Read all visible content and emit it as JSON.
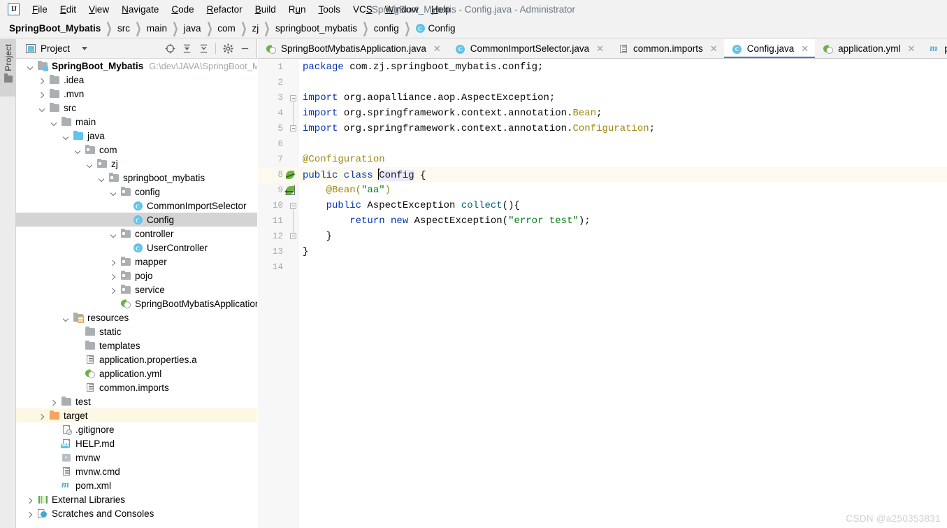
{
  "window": {
    "title": "SpringBoot_Mybatis - Config.java - Administrator",
    "logo": "IJ"
  },
  "menubar": {
    "items": [
      {
        "label": "File",
        "mnemonic": "F"
      },
      {
        "label": "Edit",
        "mnemonic": "E"
      },
      {
        "label": "View",
        "mnemonic": "V"
      },
      {
        "label": "Navigate",
        "mnemonic": "N"
      },
      {
        "label": "Code",
        "mnemonic": "C"
      },
      {
        "label": "Refactor",
        "mnemonic": "R"
      },
      {
        "label": "Build",
        "mnemonic": "B"
      },
      {
        "label": "Run",
        "mnemonic": "u"
      },
      {
        "label": "Tools",
        "mnemonic": "T"
      },
      {
        "label": "VCS",
        "mnemonic": "S"
      },
      {
        "label": "Window",
        "mnemonic": "W"
      },
      {
        "label": "Help",
        "mnemonic": "H"
      }
    ]
  },
  "breadcrumb": {
    "items": [
      "SpringBoot_Mybatis",
      "src",
      "main",
      "java",
      "com",
      "zj",
      "springboot_mybatis",
      "config",
      "Config"
    ],
    "last_icon": "class-icon",
    "last_badge": "C",
    "separator": "❯"
  },
  "toolstrip": {
    "project_tab": "Project",
    "project_tab_icon": "folder-icon"
  },
  "project_panel": {
    "title": "Project",
    "title_icon": "project-view-icon",
    "dropdown_icon": "chevron-down-icon",
    "tools": [
      {
        "name": "select-opened-file-icon"
      },
      {
        "name": "expand-all-icon"
      },
      {
        "name": "collapse-all-icon"
      },
      {
        "name": "settings-gear-icon"
      },
      {
        "name": "hide-panel-icon"
      }
    ],
    "tree": [
      {
        "label": "SpringBoot_Mybatis",
        "path": "G:\\dev\\JAVA\\SpringBoot_Myb",
        "indent": 0,
        "arrow": "down",
        "icon": "module-folder-icon",
        "bold": true,
        "state": "none"
      },
      {
        "label": ".idea",
        "indent": 1,
        "arrow": "right",
        "icon": "folder-icon",
        "state": "none"
      },
      {
        "label": ".mvn",
        "indent": 1,
        "arrow": "right",
        "icon": "folder-icon",
        "state": "none"
      },
      {
        "label": "src",
        "indent": 1,
        "arrow": "down",
        "icon": "folder-icon",
        "state": "none"
      },
      {
        "label": "main",
        "indent": 2,
        "arrow": "down",
        "icon": "folder-icon",
        "state": "none"
      },
      {
        "label": "java",
        "indent": 3,
        "arrow": "down",
        "icon": "source-folder-icon",
        "state": "none"
      },
      {
        "label": "com",
        "indent": 4,
        "arrow": "down",
        "icon": "package-icon",
        "state": "none"
      },
      {
        "label": "zj",
        "indent": 5,
        "arrow": "down",
        "icon": "package-icon",
        "state": "none"
      },
      {
        "label": "springboot_mybatis",
        "indent": 6,
        "arrow": "down",
        "icon": "package-icon",
        "state": "none"
      },
      {
        "label": "config",
        "indent": 7,
        "arrow": "down",
        "icon": "package-icon",
        "state": "none"
      },
      {
        "label": "CommonImportSelector",
        "indent": 8,
        "arrow": "none",
        "icon": "class-icon",
        "state": "none"
      },
      {
        "label": "Config",
        "indent": 8,
        "arrow": "none",
        "icon": "class-icon",
        "state": "selected"
      },
      {
        "label": "controller",
        "indent": 7,
        "arrow": "down",
        "icon": "package-icon",
        "state": "none"
      },
      {
        "label": "UserController",
        "indent": 8,
        "arrow": "none",
        "icon": "class-icon",
        "state": "none"
      },
      {
        "label": "mapper",
        "indent": 7,
        "arrow": "right",
        "icon": "package-icon",
        "state": "none"
      },
      {
        "label": "pojo",
        "indent": 7,
        "arrow": "right",
        "icon": "package-icon",
        "state": "none"
      },
      {
        "label": "service",
        "indent": 7,
        "arrow": "right",
        "icon": "package-icon",
        "state": "none"
      },
      {
        "label": "SpringBootMybatisApplication",
        "indent": 7,
        "arrow": "none",
        "icon": "spring-class-icon",
        "state": "none"
      },
      {
        "label": "resources",
        "indent": 3,
        "arrow": "down",
        "icon": "resource-folder-icon",
        "state": "none"
      },
      {
        "label": "static",
        "indent": 4,
        "arrow": "none",
        "icon": "folder-icon",
        "state": "none"
      },
      {
        "label": "templates",
        "indent": 4,
        "arrow": "none",
        "icon": "folder-icon",
        "state": "none"
      },
      {
        "label": "application.properties.a",
        "indent": 4,
        "arrow": "none",
        "icon": "properties-file-icon",
        "state": "none"
      },
      {
        "label": "application.yml",
        "indent": 4,
        "arrow": "none",
        "icon": "spring-yaml-icon",
        "state": "none"
      },
      {
        "label": "common.imports",
        "indent": 4,
        "arrow": "none",
        "icon": "text-file-icon",
        "state": "none"
      },
      {
        "label": "test",
        "indent": 2,
        "arrow": "right",
        "icon": "folder-icon",
        "state": "none"
      },
      {
        "label": "target",
        "indent": 1,
        "arrow": "right",
        "icon": "target-folder-icon",
        "state": "highlighted"
      },
      {
        "label": ".gitignore",
        "indent": 2,
        "arrow": "none",
        "icon": "gitignore-file-icon",
        "state": "none"
      },
      {
        "label": "HELP.md",
        "indent": 2,
        "arrow": "none",
        "icon": "markdown-file-icon",
        "state": "none"
      },
      {
        "label": "mvnw",
        "indent": 2,
        "arrow": "none",
        "icon": "shell-script-icon",
        "state": "none"
      },
      {
        "label": "mvnw.cmd",
        "indent": 2,
        "arrow": "none",
        "icon": "text-file-icon",
        "state": "none"
      },
      {
        "label": "pom.xml",
        "indent": 2,
        "arrow": "none",
        "icon": "maven-file-icon",
        "state": "none"
      },
      {
        "label": "External Libraries",
        "indent": 0,
        "arrow": "right",
        "icon": "libraries-icon",
        "state": "none"
      },
      {
        "label": "Scratches and Consoles",
        "indent": 0,
        "arrow": "right",
        "icon": "scratches-icon",
        "state": "none"
      }
    ]
  },
  "editor": {
    "tabs": [
      {
        "label": "SpringBootMybatisApplication.java",
        "icon": "spring-class-icon",
        "active": false,
        "closable": true
      },
      {
        "label": "CommonImportSelector.java",
        "icon": "class-icon",
        "active": false,
        "closable": true
      },
      {
        "label": "common.imports",
        "icon": "text-file-icon",
        "active": false,
        "closable": true
      },
      {
        "label": "Config.java",
        "icon": "class-icon",
        "active": true,
        "closable": true
      },
      {
        "label": "application.yml",
        "icon": "spring-yaml-icon",
        "active": false,
        "closable": true
      },
      {
        "label": "pom.xml (Spring",
        "icon": "maven-file-icon",
        "active": false,
        "closable": false
      }
    ],
    "current_line": 8,
    "lines": [
      {
        "n": 1,
        "gutter": "none",
        "fold": "none",
        "tokens": [
          {
            "t": "package",
            "c": "kw"
          },
          {
            "t": " com.zj.springboot_mybatis.config;",
            "c": "plain"
          }
        ]
      },
      {
        "n": 2,
        "gutter": "none",
        "fold": "none",
        "tokens": []
      },
      {
        "n": 3,
        "gutter": "none",
        "fold": "start",
        "tokens": [
          {
            "t": "import",
            "c": "kw"
          },
          {
            "t": " org.aopalliance.aop.AspectException;",
            "c": "plain"
          }
        ]
      },
      {
        "n": 4,
        "gutter": "none",
        "fold": "mid",
        "tokens": [
          {
            "t": "import",
            "c": "kw"
          },
          {
            "t": " org.springframework.context.annotation.",
            "c": "plain"
          },
          {
            "t": "Bean",
            "c": "anno"
          },
          {
            "t": ";",
            "c": "plain"
          }
        ]
      },
      {
        "n": 5,
        "gutter": "none",
        "fold": "end",
        "tokens": [
          {
            "t": "import",
            "c": "kw"
          },
          {
            "t": " org.springframework.context.annotation.",
            "c": "plain"
          },
          {
            "t": "Configuration",
            "c": "anno"
          },
          {
            "t": ";",
            "c": "plain"
          }
        ]
      },
      {
        "n": 6,
        "gutter": "none",
        "fold": "none",
        "tokens": []
      },
      {
        "n": 7,
        "gutter": "none",
        "fold": "none",
        "tokens": [
          {
            "t": "@Configuration",
            "c": "anno"
          }
        ]
      },
      {
        "n": 8,
        "gutter": "bean",
        "fold": "none",
        "tokens": [
          {
            "t": "public class ",
            "c": "kw"
          },
          {
            "t": "│",
            "c": "caret"
          },
          {
            "t": "Config",
            "c": "idsel"
          },
          {
            "t": " {",
            "c": "plain"
          }
        ]
      },
      {
        "n": 9,
        "gutter": "bean-arrow",
        "fold": "none",
        "tokens": [
          {
            "t": "    ",
            "c": "plain"
          },
          {
            "t": "@Bean(",
            "c": "anno"
          },
          {
            "t": "\"aa\"",
            "c": "str"
          },
          {
            "t": ")",
            "c": "anno"
          }
        ]
      },
      {
        "n": 10,
        "gutter": "none",
        "fold": "start",
        "tokens": [
          {
            "t": "    ",
            "c": "plain"
          },
          {
            "t": "public",
            "c": "kw"
          },
          {
            "t": " AspectException ",
            "c": "plain"
          },
          {
            "t": "collect",
            "c": "meth"
          },
          {
            "t": "(){",
            "c": "plain"
          }
        ]
      },
      {
        "n": 11,
        "gutter": "none",
        "fold": "mid",
        "tokens": [
          {
            "t": "        ",
            "c": "plain"
          },
          {
            "t": "return new",
            "c": "kw"
          },
          {
            "t": " AspectException(",
            "c": "plain"
          },
          {
            "t": "\"error test\"",
            "c": "str"
          },
          {
            "t": ");",
            "c": "plain"
          }
        ]
      },
      {
        "n": 12,
        "gutter": "none",
        "fold": "end",
        "tokens": [
          {
            "t": "    }",
            "c": "plain"
          }
        ]
      },
      {
        "n": 13,
        "gutter": "none",
        "fold": "none",
        "tokens": [
          {
            "t": "}",
            "c": "plain"
          }
        ]
      },
      {
        "n": 14,
        "gutter": "none",
        "fold": "none",
        "tokens": []
      }
    ]
  },
  "watermark": "CSDN @a250353831",
  "colors": {
    "accent": "#3d7fd0",
    "class_icon": "#63c2e8",
    "spring_green": "#6db33f",
    "target_folder": "#f2a565",
    "keyword": "#0033b3",
    "string": "#067d17",
    "annotation": "#9e880d",
    "method": "#00627a",
    "selection": "#d4d4d4",
    "highlight_row": "#fdf8e3"
  }
}
